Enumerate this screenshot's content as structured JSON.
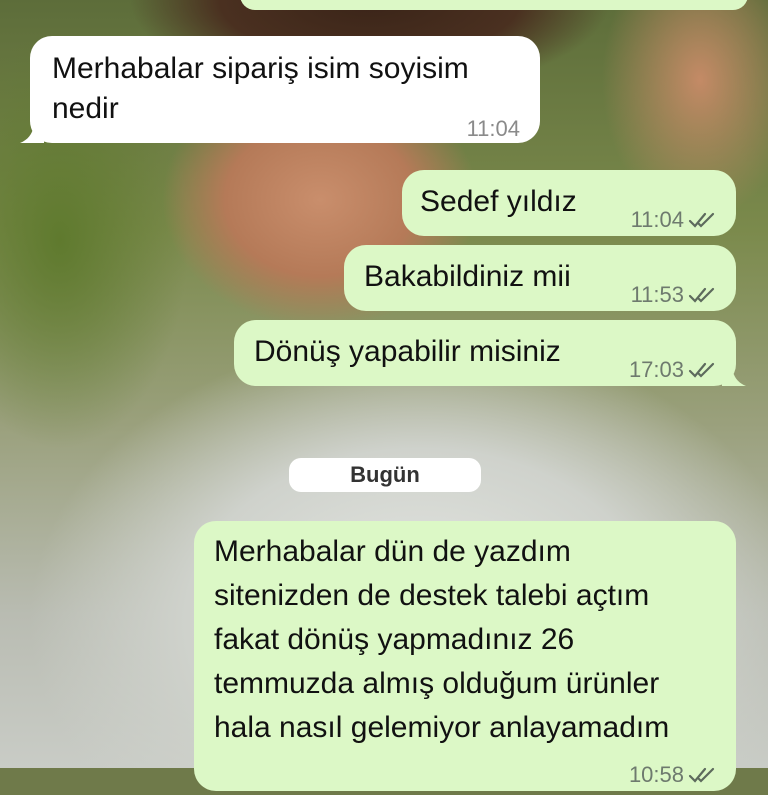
{
  "chat": {
    "messages": [
      {
        "direction": "incoming",
        "text_lines": [
          "Merhabalar sipariş isim soyisim",
          "nedir"
        ],
        "time": "11:04"
      },
      {
        "direction": "outgoing",
        "text": "Sedef yıldız",
        "time": "11:04",
        "status": "read"
      },
      {
        "direction": "outgoing",
        "text": "Bakabildiniz mii",
        "time": "11:53",
        "status": "read"
      },
      {
        "direction": "outgoing",
        "text": "Dönüş yapabilir misiniz",
        "time": "17:03",
        "status": "read"
      },
      {
        "direction": "outgoing",
        "text_lines": [
          "Merhabalar dün de yazdım",
          "sitenizden de destek talebi açtım",
          "fakat dönüş yapmadınız 26",
          "temmuzda almış olduğum ürünler",
          "hala nasıl gelemiyor anlayamadım"
        ],
        "time": "10:58",
        "status": "read"
      }
    ],
    "date_separator": "Bugün"
  },
  "colors": {
    "incoming_bubble": "#ffffff",
    "outgoing_bubble": "#dcf8c6",
    "tick": "#6e7a6e"
  },
  "icons": {
    "read_ticks": "double-check-icon"
  }
}
